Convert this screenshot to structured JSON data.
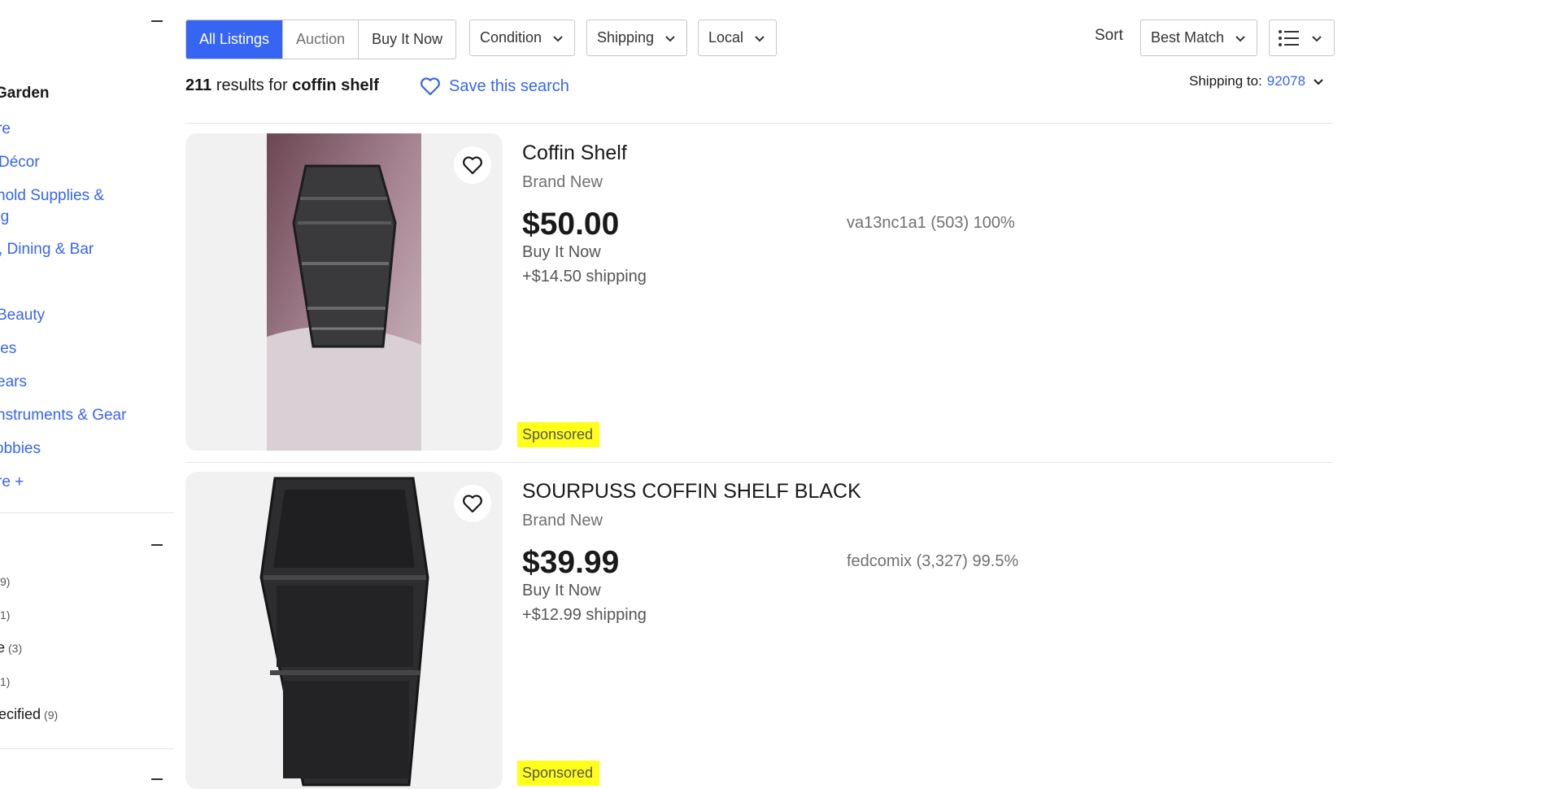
{
  "sidebar": {
    "category_heading": "Garden",
    "categories": [
      "re",
      "Décor",
      "hold Supplies &",
      "ng",
      ", Dining & Bar",
      ".",
      " Beauty",
      "les",
      "ears",
      "nstruments & Gear",
      "obbies",
      "re +"
    ],
    "filters": [
      {
        "label": "",
        "count": "9)"
      },
      {
        "label": "",
        "count": "1)"
      },
      {
        "label": "e",
        "count": "(3)"
      },
      {
        "label": "",
        "count": "1)"
      },
      {
        "label": "ecified",
        "count": "(9)"
      }
    ]
  },
  "filterbar": {
    "tabs": [
      "All Listings",
      "Auction",
      "Buy It Now"
    ],
    "dropdowns": [
      "Condition",
      "Shipping",
      "Local"
    ],
    "sort_label": "Sort",
    "sort_value": "Best Match"
  },
  "results": {
    "count": "211",
    "mid": "results for",
    "query": "coffin shelf",
    "save_search": "Save this search",
    "shipping_to_label": "Shipping to:",
    "zip": "92078"
  },
  "listings": [
    {
      "title": "Coffin Shelf",
      "condition": "Brand New",
      "price": "$50.00",
      "format": "Buy It Now",
      "shipping": "+$14.50 shipping",
      "seller": "va13nc1a1 (503) 100%",
      "sponsored": "Sponsored"
    },
    {
      "title": "SOURPUSS COFFIN SHELF BLACK",
      "condition": "Brand New",
      "price": "$39.99",
      "format": "Buy It Now",
      "shipping": "+$12.99 shipping",
      "seller": "fedcomix (3,327) 99.5%",
      "sponsored": "Sponsored"
    }
  ],
  "colors": {
    "accent": "#3665f3",
    "sponsored_bg": "#ffff19"
  }
}
